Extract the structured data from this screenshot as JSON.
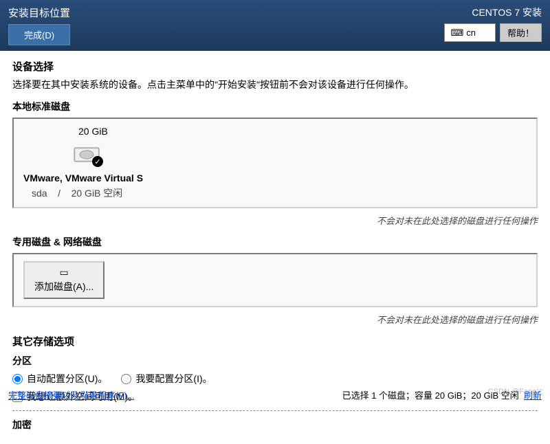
{
  "header": {
    "title": "安装目标位置",
    "done_label": "完成(D)",
    "subtitle": "CENTOS 7 安装",
    "lang": "cn",
    "help_label": "帮助！"
  },
  "device_select": {
    "title": "设备选择",
    "desc": "选择要在其中安装系统的设备。点击主菜单中的\"开始安装\"按钮前不会对该设备进行任何操作。"
  },
  "local_disks": {
    "title": "本地标准磁盘",
    "disk": {
      "size": "20 GiB",
      "name": "VMware, VMware Virtual S",
      "dev": "sda",
      "sep": "/",
      "free": "20 GiB 空闲"
    },
    "note": "不会对未在此处选择的磁盘进行任何操作"
  },
  "network_disks": {
    "title": "专用磁盘 & 网络磁盘",
    "add_label": "添加磁盘(A)...",
    "note": "不会对未在此处选择的磁盘进行任何操作"
  },
  "storage": {
    "title": "其它存储选项",
    "partition_label": "分区",
    "auto_label": "自动配置分区(U)。",
    "manual_label": "我要配置分区(I)。",
    "extra_label": "我想让额外空间可用(M)。",
    "encrypt_label": "加密"
  },
  "footer": {
    "link": "完整磁盘摘要以及引导程序(F)...",
    "status": "已选择 1 个磁盘；容量 20 GiB；20 GiB 空闲",
    "action": "刷新"
  },
  "watermark": "CSDN @FangY:"
}
